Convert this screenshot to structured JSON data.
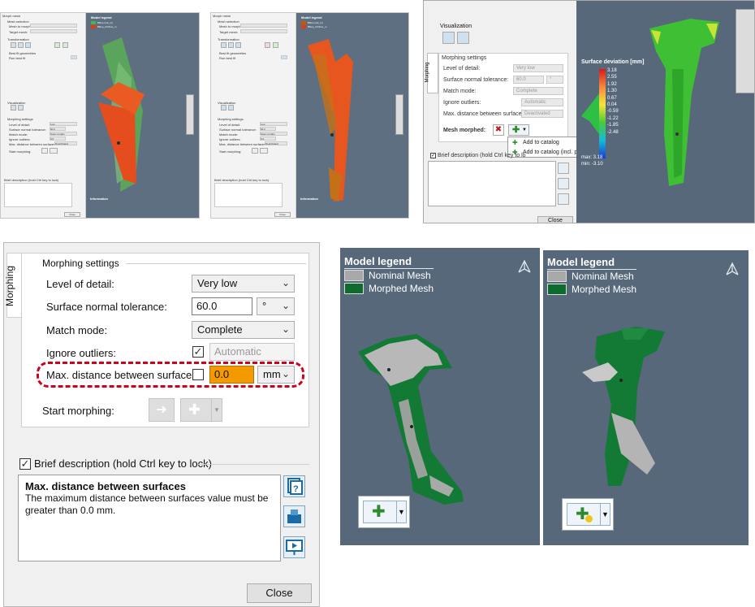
{
  "thumb1": {
    "title": "Morph mesh",
    "mesh_selection": "Mesh selection",
    "mesh_to_morph": "Mesh to morph:",
    "target_mesh": "Target mesh:",
    "transformation": "Transformation",
    "best_fit": "Best fit geometries",
    "run_best_fit": "Run best fit",
    "visualization": "Visualization",
    "morphing_settings": "Morphing settings",
    "level_of_detail": "Level of detail:",
    "surface_normal_tolerance": "Surface normal tolerance:",
    "match_mode": "Match mode:",
    "ignore_outliers": "Ignore outliers:",
    "max_distance": "Max. distance between surfaces:",
    "start_morphing": "Start morphing:",
    "brief_description": "Brief description (hold Ctrl key to lock)",
    "information": "Information",
    "close": "Close",
    "legend_title": "Model legend",
    "legend_items": [
      "BRep (nat_m)",
      "BRep_CrDrive_m"
    ],
    "legend_colors": [
      "#4caf50",
      "#e53915"
    ],
    "field_values": [
      "Low",
      "60.0",
      "Scan morphs",
      "0.0",
      "Deactivated"
    ]
  },
  "thumb2": {
    "title": "Morph mesh",
    "mesh_selection": "Mesh selection",
    "mesh_to_morph": "Mesh to morph:",
    "target_mesh": "Target mesh:",
    "transformation": "Transformation",
    "best_fit": "Best fit geometries",
    "run_best_fit": "Run best fit",
    "visualization": "Visualization",
    "morphing_settings": "Morphing settings",
    "level_of_detail": "Level of detail:",
    "surface_normal_tolerance": "Surface normal tolerance:",
    "match_mode": "Match mode:",
    "ignore_outliers": "Ignore outliers:",
    "max_distance": "Max. distance between surfaces:",
    "start_morphing": "Start morphing:",
    "brief_description": "Brief description (hold Ctrl key to lock)",
    "information": "Information",
    "close": "Close",
    "legend_title": "Model legend",
    "legend_items": [
      "BRep (nat_m)",
      "BRep_CrDrive_m"
    ],
    "legend_colors": [
      "#cc5500",
      "#e53915"
    ],
    "field_values": [
      "Low",
      "60.0",
      "Scan morphs",
      "0.0",
      "Deactivated"
    ]
  },
  "top_right": {
    "visualization": "Visualization",
    "tab_morphing": "Morphing",
    "morphing_settings": "Morphing settings",
    "level_of_detail": "Level of detail:",
    "level_value": "Very low",
    "surface_normal_tolerance": "Surface normal tolerance:",
    "tolerance_value": "60.0",
    "tolerance_unit": "°",
    "match_mode": "Match mode:",
    "match_value": "Complete",
    "ignore_outliers": "Ignore outliers:",
    "outliers_value": "Automatic",
    "max_distance": "Max. distance between surfaces:",
    "max_distance_value": "Deactivated",
    "mesh_morphed": "Mesh morphed:",
    "menu_items": [
      "Add to catalog",
      "Add to catalog (incl. positioning)"
    ],
    "brief_description": "Brief description (hold Ctrl key to lo",
    "close": "Close",
    "deviation_title": "Surface deviation [mm]",
    "scale_labels": [
      "3.18",
      "2.55",
      "1.92",
      "1.30",
      "0.67",
      "0.04",
      "-0.59",
      "-1.22",
      "-1.85",
      "-2.48"
    ],
    "max_label": "max: 3.18",
    "min_label": "min: -3.10"
  },
  "main_panel": {
    "tab_label": "Morphing",
    "section_title": "Morphing settings",
    "level_of_detail_label": "Level of detail:",
    "level_of_detail_value": "Very low",
    "normal_tolerance_label": "Surface normal tolerance:",
    "normal_tolerance_value": "60.0",
    "normal_tolerance_unit": "°",
    "match_mode_label": "Match mode:",
    "match_mode_value": "Complete",
    "ignore_outliers_label": "Ignore outliers:",
    "ignore_outliers_checked": "✓",
    "ignore_outliers_value": "Automatic",
    "max_distance_label": "Max. distance between surfaces:",
    "max_distance_value": "0.0",
    "max_distance_unit": "mm",
    "start_morphing_label": "Start morphing:",
    "brief_description_checked": "✓",
    "brief_description_label": "Brief description (hold Ctrl key to lock)",
    "description_title": "Max. distance between surfaces",
    "description_text": "The maximum distance between surfaces value must be greater than 0.0 mm.",
    "close_label": "Close"
  },
  "legend_left": {
    "title": "Model legend",
    "items": [
      "Nominal Mesh",
      "Morphed Mesh"
    ],
    "colors": [
      "#a8a8a8",
      "#0d6b2e"
    ]
  },
  "legend_right": {
    "title": "Model legend",
    "items": [
      "Nominal Mesh",
      "Morphed Mesh"
    ],
    "colors": [
      "#a8a8a8",
      "#0d6b2e"
    ]
  },
  "colors": {
    "highlight_orange": "#f29a00",
    "dash_red": "#d0021b",
    "view_bg": "#56687a"
  }
}
